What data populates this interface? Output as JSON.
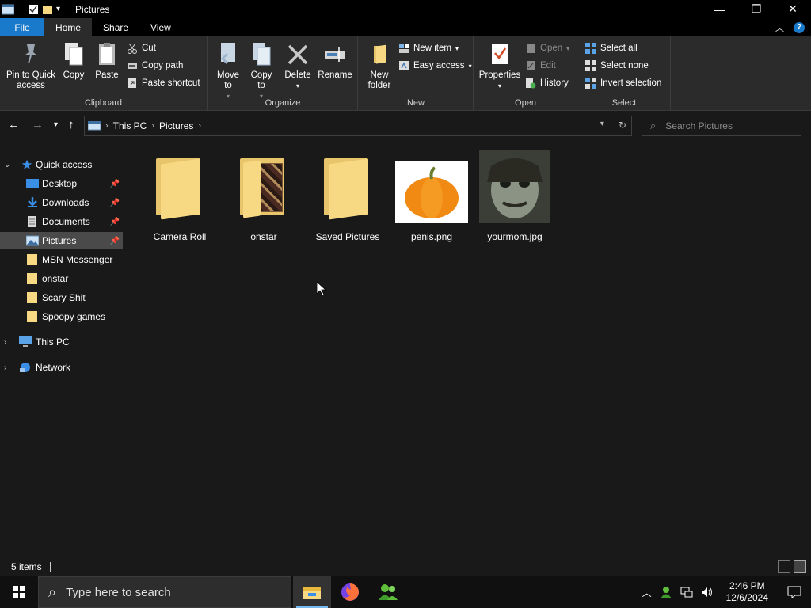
{
  "window": {
    "title": "Pictures"
  },
  "tabs": {
    "file": "File",
    "home": "Home",
    "share": "Share",
    "view": "View"
  },
  "ribbon": {
    "clipboard": {
      "label": "Clipboard",
      "pin": "Pin to Quick access",
      "copy": "Copy",
      "paste": "Paste",
      "cut": "Cut",
      "copy_path": "Copy path",
      "paste_shortcut": "Paste shortcut"
    },
    "organize": {
      "label": "Organize",
      "move_to": "Move to",
      "copy_to": "Copy to",
      "delete": "Delete",
      "rename": "Rename"
    },
    "new": {
      "label": "New",
      "new_folder": "New folder",
      "new_item": "New item",
      "easy_access": "Easy access"
    },
    "open": {
      "label": "Open",
      "properties": "Properties",
      "open": "Open",
      "edit": "Edit",
      "history": "History"
    },
    "select": {
      "label": "Select",
      "select_all": "Select all",
      "select_none": "Select none",
      "invert": "Invert selection"
    }
  },
  "address": {
    "crumbs": [
      "This PC",
      "Pictures"
    ],
    "search_placeholder": "Search Pictures"
  },
  "nav": {
    "quick_access": "Quick access",
    "items": [
      "Desktop",
      "Downloads",
      "Documents",
      "Pictures",
      "MSN Messenger",
      "onstar",
      "Scary Shit",
      "Spoopy games"
    ],
    "this_pc": "This PC",
    "network": "Network"
  },
  "files": [
    {
      "name": "Camera Roll",
      "kind": "folder"
    },
    {
      "name": "onstar",
      "kind": "folder-preview"
    },
    {
      "name": "Saved Pictures",
      "kind": "folder"
    },
    {
      "name": "penis.png",
      "kind": "image-pumpkin"
    },
    {
      "name": "yourmom.jpg",
      "kind": "image-face"
    }
  ],
  "status": {
    "count": "5 items"
  },
  "taskbar": {
    "search_placeholder": "Type here to search",
    "time": "2:46 PM",
    "date": "12/6/2024"
  },
  "colors": {
    "accent": "#1979ca",
    "folder": "#f7d983",
    "selected": "#4a4a4a"
  }
}
